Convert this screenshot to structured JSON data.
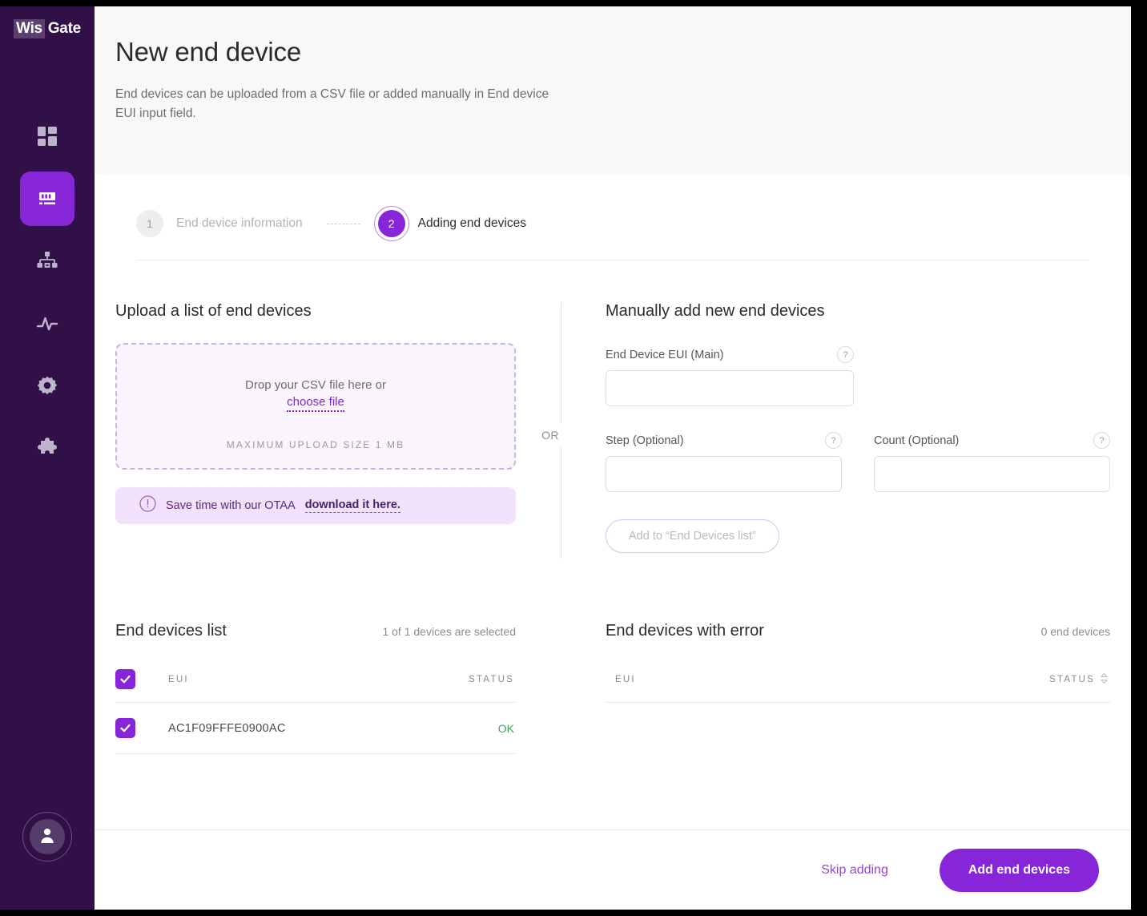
{
  "brand": {
    "part1": "Wis",
    "part2": "Gate"
  },
  "sidebar": {
    "items": [
      {
        "name": "dashboard",
        "icon": "grid-icon"
      },
      {
        "name": "devices",
        "icon": "device-icon",
        "active": true
      },
      {
        "name": "network",
        "icon": "network-icon"
      },
      {
        "name": "activity",
        "icon": "pulse-icon"
      },
      {
        "name": "settings",
        "icon": "gear-icon"
      },
      {
        "name": "extensions",
        "icon": "puzzle-icon"
      }
    ],
    "avatar_icon": "user-icon"
  },
  "header": {
    "title": "New end device",
    "subtitle": "End devices can be uploaded from a CSV file or added manually in End device EUI input field."
  },
  "stepper": {
    "steps": [
      {
        "number": "1",
        "label": "End device information",
        "state": "inactive"
      },
      {
        "number": "2",
        "label": "Adding end devices",
        "state": "current"
      }
    ]
  },
  "upload": {
    "title": "Upload a list of end devices",
    "drop_text": "Drop your CSV file here or",
    "choose_file": "choose file",
    "max_size": "MAXIMUM UPLOAD SIZE 1 MB",
    "banner": {
      "icon": "exclamation-circle-icon",
      "text": "Save time with our OTAA",
      "link": "download it here."
    }
  },
  "divider": {
    "or": "OR"
  },
  "manual": {
    "title": "Manually add new end devices",
    "eui": {
      "label": "End Device EUI (Main)",
      "value": "",
      "placeholder": ""
    },
    "step": {
      "label": "Step (Optional)",
      "value": "",
      "placeholder": ""
    },
    "count": {
      "label": "Count (Optional)",
      "value": "",
      "placeholder": ""
    },
    "add_button": "Add to “End Devices list”",
    "help_glyph": "?"
  },
  "devices_list": {
    "title": "End devices list",
    "count_text": "1 of 1 devices are selected",
    "columns": {
      "eui": "EUI",
      "status": "STATUS"
    },
    "rows": [
      {
        "checked": true,
        "eui": "AC1F09FFFE0900AC",
        "status": "OK"
      }
    ]
  },
  "error_list": {
    "title": "End devices with error",
    "count_text": "0 end devices",
    "columns": {
      "eui": "EUI",
      "status": "STATUS"
    },
    "sort_icon": "sort-arrows-icon",
    "rows": []
  },
  "footer": {
    "skip_label": "Skip adding",
    "primary_label": "Add end devices"
  },
  "colors": {
    "sidebar_bg": "#311047",
    "accent": "#8726D9",
    "banner_bg": "#F1E1FB",
    "dropzone_bg": "#FAF5FD",
    "status_ok": "#33A852"
  }
}
